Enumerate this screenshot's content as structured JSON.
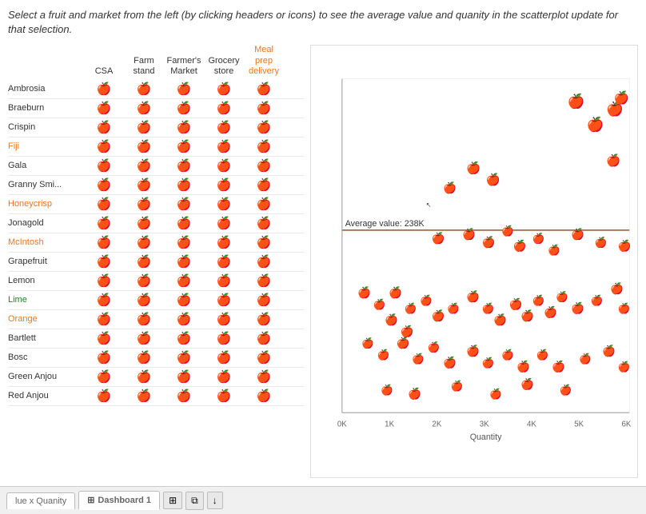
{
  "instruction": "Select a fruit and market from the left (by clicking  headers or icons) to see the average value and quanity in the scatterplot update for that selection.",
  "table": {
    "columns": [
      {
        "id": "fruit",
        "label": ""
      },
      {
        "id": "csa",
        "label": "CSA",
        "highlight": false
      },
      {
        "id": "farm_stand",
        "label": "Farm stand",
        "highlight": false
      },
      {
        "id": "farmers_market",
        "label": "Farmer's Market",
        "highlight": false
      },
      {
        "id": "grocery_store",
        "label": "Grocery store",
        "highlight": false
      },
      {
        "id": "meal_prep",
        "label": "Meal prep delivery",
        "highlight": true
      }
    ],
    "rows": [
      {
        "name": "Ambrosia",
        "style": "",
        "icons": [
          "teal",
          "green",
          "orange",
          "yellow",
          "dark"
        ]
      },
      {
        "name": "Braeburn",
        "style": "",
        "icons": [
          "teal",
          "green",
          "orange",
          "yellow",
          "dark"
        ]
      },
      {
        "name": "Crispin",
        "style": "",
        "icons": [
          "teal",
          "green",
          "orange",
          "yellow",
          "dark"
        ]
      },
      {
        "name": "Fiji",
        "style": "orange",
        "icons": [
          "teal",
          "green",
          "orange",
          "yellow",
          "dark"
        ]
      },
      {
        "name": "Gala",
        "style": "",
        "icons": [
          "teal",
          "green",
          "orange",
          "yellow",
          "dark"
        ]
      },
      {
        "name": "Granny Smi...",
        "style": "",
        "icons": [
          "teal",
          "green",
          "orange",
          "yellow",
          "dark"
        ]
      },
      {
        "name": "Honeycrisp",
        "style": "orange",
        "icons": [
          "teal",
          "green",
          "orange",
          "yellow",
          "dark"
        ]
      },
      {
        "name": "Jonagold",
        "style": "",
        "icons": [
          "teal",
          "green",
          "orange",
          "yellow",
          "dark"
        ]
      },
      {
        "name": "McIntosh",
        "style": "orange",
        "icons": [
          "teal",
          "green",
          "orange",
          "yellow",
          "dark"
        ]
      },
      {
        "name": "Grapefruit",
        "style": "",
        "icons": [
          "teal",
          "green",
          "orange",
          "yellow",
          "dark"
        ]
      },
      {
        "name": "Lemon",
        "style": "",
        "icons": [
          "teal",
          "green",
          "orange",
          "yellow",
          "dark"
        ]
      },
      {
        "name": "Lime",
        "style": "green",
        "icons": [
          "teal",
          "green",
          "orange",
          "yellow",
          "dark"
        ]
      },
      {
        "name": "Orange",
        "style": "orange",
        "icons": [
          "teal",
          "green",
          "orange",
          "yellow",
          "dark"
        ]
      },
      {
        "name": "Bartlett",
        "style": "",
        "icons": [
          "teal",
          "green",
          "orange",
          "yellow",
          "dark"
        ]
      },
      {
        "name": "Bosc",
        "style": "",
        "icons": [
          "teal",
          "green",
          "orange",
          "yellow",
          "dark"
        ]
      },
      {
        "name": "Green Anjou",
        "style": "",
        "icons": [
          "teal",
          "green",
          "orange",
          "yellow",
          "dark"
        ]
      },
      {
        "name": "Red Anjou",
        "style": "",
        "icons": [
          "teal",
          "green",
          "orange",
          "yellow",
          "dark"
        ]
      }
    ]
  },
  "scatter": {
    "xaxis_label": "Quantity",
    "xaxis_ticks": [
      "0K",
      "1K",
      "2K",
      "3K",
      "4K",
      "5K",
      "6K"
    ],
    "yaxis_label": "",
    "average_value_label": "Average value: 238K",
    "average_y_pct": 47
  },
  "tabs": {
    "tab1_label": "lue x Quanity",
    "tab2_label": "Dashboard 1",
    "buttons": [
      "new-sheet",
      "duplicate-sheet",
      "download-sheet"
    ]
  }
}
